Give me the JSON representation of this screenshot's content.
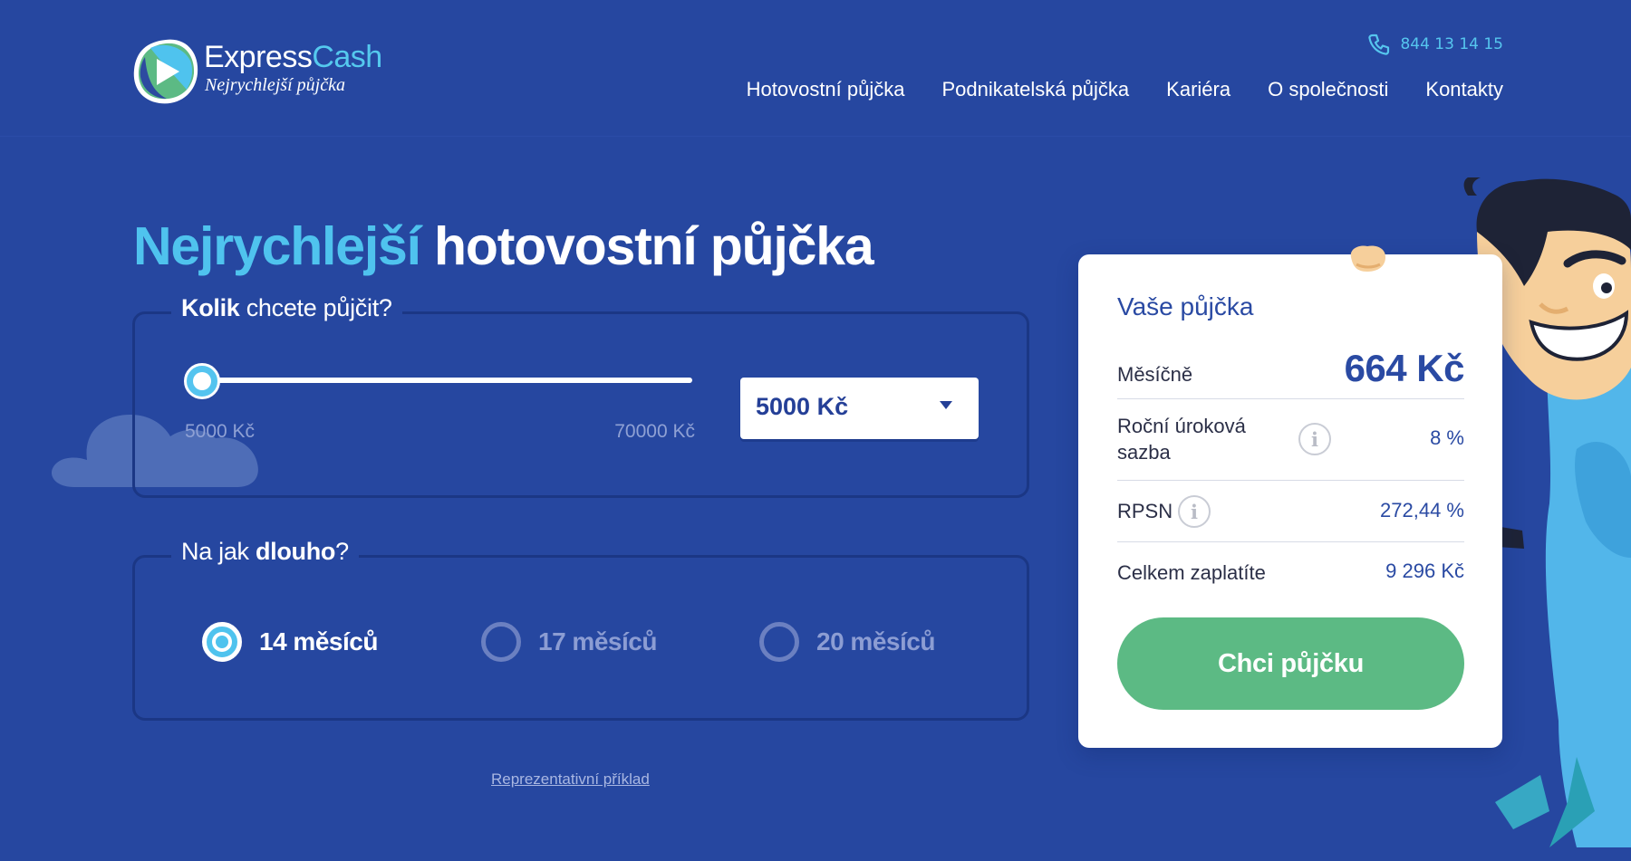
{
  "brand": {
    "name_part1": "Express",
    "name_part2": "Cash",
    "tagline": "Nejrychlejší půjčka"
  },
  "header": {
    "phone": "844 13 14 15",
    "nav": [
      "Hotovostní půjčka",
      "Podnikatelská půjčka",
      "Kariéra",
      "O společnosti",
      "Kontakty"
    ]
  },
  "hero": {
    "title_accent": "Nejrychlejší",
    "title_rest": "hotovostní půjčka"
  },
  "amount": {
    "legend_bold": "Kolik",
    "legend_rest": "chcete půjčit?",
    "min_label": "5000 Kč",
    "max_label": "70000 Kč",
    "selected": "5000 Kč",
    "slider_fraction": 0
  },
  "term": {
    "legend_pre": "Na jak",
    "legend_bold": "dlouho",
    "legend_post": "?",
    "options": [
      "14 měsíců",
      "17 měsíců",
      "20 měsíců"
    ],
    "selected_index": 0
  },
  "representative_link": "Reprezentativní příklad",
  "card": {
    "title": "Vaše půjčka",
    "monthly_label": "Měsíčně",
    "monthly_value": "664 Kč",
    "rate_label": "Roční úroková sazba",
    "rate_value": "8 %",
    "rpsn_label": "RPSN",
    "rpsn_value": "272,44 %",
    "total_label": "Celkem zaplatíte",
    "total_value": "9 296 Kč",
    "cta": "Chci půjčku"
  },
  "colors": {
    "background": "#2647a0",
    "accent_blue": "#4fc3ee",
    "cta_green": "#5cba84",
    "card_text": "#243f97"
  },
  "icons": [
    "logo-play-icon",
    "phone-icon",
    "dropdown-caret-icon",
    "info-icon"
  ]
}
